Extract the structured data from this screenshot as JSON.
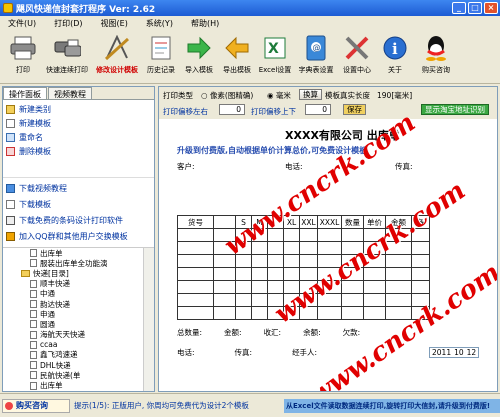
{
  "window": {
    "title": "飓风快递信封套打程序 Ver: 2.62"
  },
  "menu": [
    "文件(U)",
    "打印(D)",
    "视图(E)",
    "系统(Y)",
    "帮助(H)"
  ],
  "toolbar": [
    {
      "label": "打印",
      "icon": "printer-icon"
    },
    {
      "label": "快速连续打印",
      "icon": "multi-printer-icon"
    },
    {
      "label": "修改设计模板",
      "icon": "design-tools-icon",
      "highlight": true
    },
    {
      "label": "历史记录",
      "icon": "history-icon"
    },
    {
      "label": "导入模板",
      "icon": "import-arrow-icon"
    },
    {
      "label": "导出模板",
      "icon": "export-arrow-icon"
    },
    {
      "label": "Excel设置",
      "icon": "excel-icon"
    },
    {
      "label": "字典表设置",
      "icon": "address-book-icon"
    },
    {
      "label": "设置中心",
      "icon": "wrench-icon"
    },
    {
      "label": "关于",
      "icon": "info-icon"
    },
    {
      "label": "购买咨询",
      "icon": "qq-icon"
    }
  ],
  "left_panel": {
    "tabs": [
      "操作面板",
      "视频教程"
    ],
    "actions": [
      "新建类别",
      "新建模板",
      "重命名",
      "删除模板"
    ],
    "downloads": [
      "下载视频教程",
      "下载模板",
      "下载免费的条码设计打印软件",
      "加入QQ群和其他用户交换模板"
    ],
    "tree": [
      {
        "label": "出库单",
        "type": "doc",
        "indent": 3
      },
      {
        "label": "服装出库单全功能演",
        "type": "doc",
        "indent": 3
      },
      {
        "label": "快递[目录]",
        "type": "folder",
        "indent": 2
      },
      {
        "label": "顺丰快递",
        "type": "doc",
        "indent": 3
      },
      {
        "label": "中通",
        "type": "doc",
        "indent": 3
      },
      {
        "label": "韵达快递",
        "type": "doc",
        "indent": 3
      },
      {
        "label": "申通",
        "type": "doc",
        "indent": 3
      },
      {
        "label": "圆通",
        "type": "doc",
        "indent": 3
      },
      {
        "label": "海航天天快递",
        "type": "doc",
        "indent": 3
      },
      {
        "label": "ccaa",
        "type": "doc",
        "indent": 3
      },
      {
        "label": "鑫飞鸿速递",
        "type": "doc",
        "indent": 3
      },
      {
        "label": "DHL快递",
        "type": "doc",
        "indent": 3
      },
      {
        "label": "民航快递(单",
        "type": "doc",
        "indent": 3
      },
      {
        "label": "出库单",
        "type": "doc",
        "indent": 3
      }
    ]
  },
  "options": {
    "print_type_label": "打印类型",
    "mode_a": "像素(图精确)",
    "mode_b": "毫米",
    "convert_btn": "换算",
    "length_label": "模板真实长度",
    "length_value": "190[毫米]",
    "offset_lr_label": "打印偏移左右",
    "offset_lr_value": "0",
    "offset_ud_label": "打印偏移上下",
    "offset_ud_value": "0",
    "save_btn": "保存",
    "show_grid_btn": "显示淘宝地址识别"
  },
  "template": {
    "company": "XXXX有限公司  出库单",
    "promo": "升级到付费版,自动根据单价计算总价,可免费设计模板",
    "customer_label": "客户:",
    "phone_label": "电话:",
    "fax_label": "传真:",
    "columns": [
      "货号",
      "",
      "S",
      "M",
      "",
      "XL",
      "XXL",
      "XXXL",
      "数量",
      "单价",
      "金额",
      "备"
    ],
    "footer1": [
      "总数量:",
      "金额:",
      "收汇:",
      "余额:",
      "欠款:"
    ],
    "footer2": [
      "电话:",
      "传真:",
      "经手人:"
    ],
    "date_parts": [
      "2011",
      "10",
      "12"
    ]
  },
  "watermark": "www.cncrk.com",
  "status": {
    "buy_label": "购买咨询",
    "tip": "提示(1/5): 正版用户, 你周均可免费代为设计2个模板",
    "marquee": "从Excel文件读取数据连续打印,旋转打印大信封,请升级到付费版!"
  },
  "colors": {
    "titlebar": "#1c5bd3",
    "link": "#0033a0",
    "watermark": "#e00000",
    "highlight": "#d00000"
  }
}
